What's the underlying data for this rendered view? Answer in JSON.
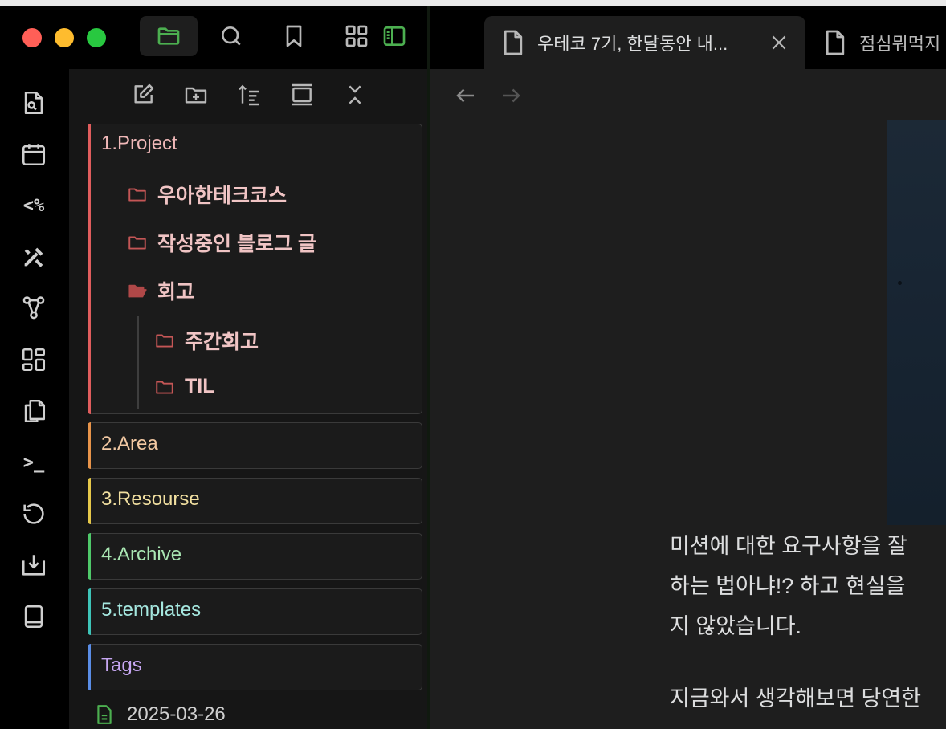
{
  "window": {
    "traffic_lights": [
      "close",
      "minimize",
      "zoom"
    ],
    "colors": {
      "close": "#ff5f57",
      "minimize": "#febc2e",
      "zoom": "#28c840",
      "accent": "#4caf50"
    }
  },
  "titlebar": {
    "icons": [
      "folder-icon",
      "search-icon",
      "bookmark-icon",
      "grid-icon",
      "sidebar-toggle-icon"
    ]
  },
  "tabs": [
    {
      "title": "우테코 7기, 한달동안 내...",
      "active": true
    },
    {
      "title": "점심뭐먹지",
      "active": false
    }
  ],
  "ribbon": {
    "items": [
      "search-file-icon",
      "calendar-icon",
      "templater-icon",
      "excalidraw-icon",
      "graph-icon",
      "dashboard-icon",
      "copy-icon",
      "terminal-icon",
      "history-icon",
      "import-icon",
      "book-icon"
    ],
    "templater_text": "<%",
    "terminal_text": ">_"
  },
  "explorer": {
    "toolbar": [
      "new-note-icon",
      "new-folder-icon",
      "sort-icon",
      "collapse-view-icon",
      "collapse-all-icon"
    ],
    "folders": [
      {
        "label": "1.Project",
        "color": "#e05d5d",
        "text_color": "#f0b8b8",
        "expanded": true
      },
      {
        "label": "2.Area",
        "color": "#e8944a",
        "text_color": "#f3c9a3"
      },
      {
        "label": "3.Resourse",
        "color": "#e6c84a",
        "text_color": "#f1dfa0"
      },
      {
        "label": "4.Archive",
        "color": "#4fc96a",
        "text_color": "#a9e6b2"
      },
      {
        "label": "5.templates",
        "color": "#3ec4b8",
        "text_color": "#a5e7df"
      },
      {
        "label": "Tags",
        "color": "#5a8de6",
        "text_color": "#c7a7f2"
      }
    ],
    "project_children": [
      {
        "label": "우아한테크코스"
      },
      {
        "label": "작성중인 블로그 글"
      },
      {
        "label": "회고",
        "open": true
      }
    ],
    "retro_children": [
      {
        "label": "주간회고"
      },
      {
        "label": "TIL"
      }
    ],
    "file": {
      "label": "2025-03-26"
    }
  },
  "editor": {
    "paragraphs": [
      "미션에 대한 요구사항을 잘 ",
      "하는 법아냐!? 하고 현실을 ",
      "지 않았습니다.",
      "지금와서 생각해보면 당연한"
    ]
  }
}
